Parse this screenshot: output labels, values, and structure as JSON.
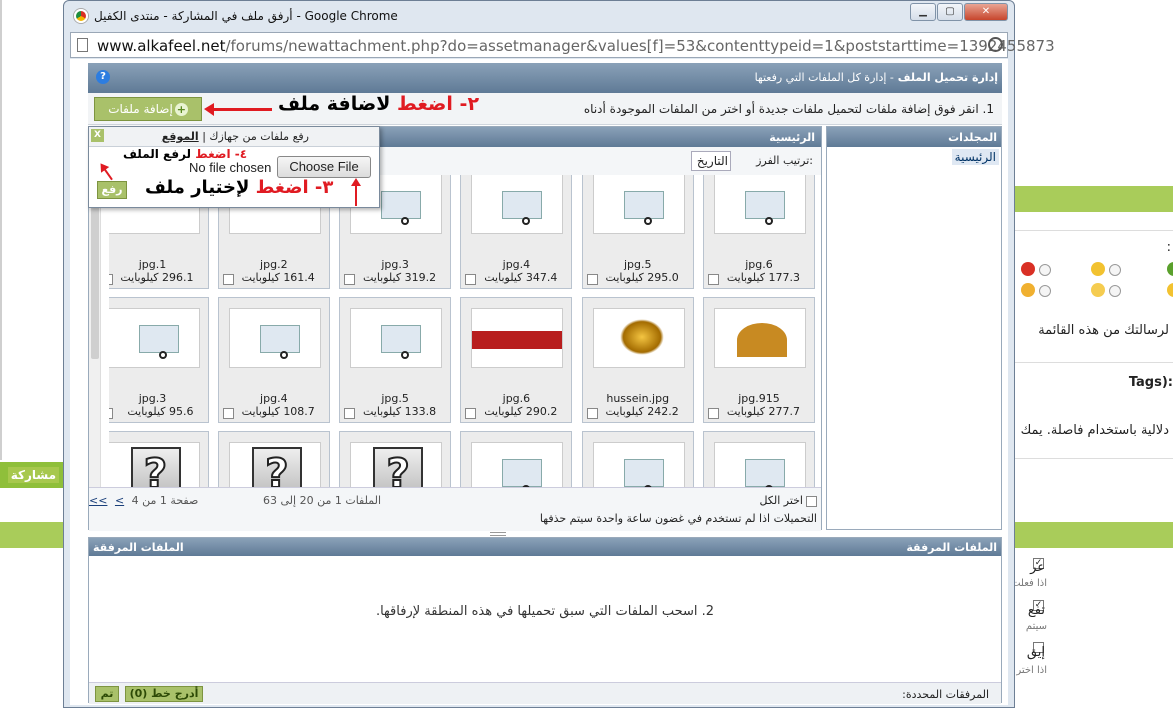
{
  "window": {
    "title": "أرفق ملف في المشاركة - منتدى الكفيل - Google Chrome",
    "url_host": "www.alkafeel.net",
    "url_path": "/forums/newattachment.php?do=assetmanager&values[f]=53&contenttypeid=1&poststarttime=1392455873"
  },
  "manager": {
    "title": "إدارة تحميل الملف",
    "subtitle": "- إدارة كل الملفات التي رفعتها",
    "instruction": "1. انقر فوق إضافة ملفات لتحميل ملفات جديدة أو اختر من الملفات الموجودة أدناه",
    "add_button": "إضافة ملفات"
  },
  "annotations": {
    "step2_num": "٢- ",
    "step2_red": "اضغط",
    "step2_black": " لاضافة ملف",
    "step3_num": "٣- ",
    "step3_red": "اضغط",
    "step3_black": " لإختيار ملف",
    "step4_num": "٤- ",
    "step4_red": "اضغط",
    "step4_black": " لرفع الملف"
  },
  "folders": {
    "title": "المجلدات",
    "item": "الرئيسية"
  },
  "files": {
    "title": "الرئيسية",
    "sort_label": "ترتيب الفرز:",
    "sort_value": "التاريخ",
    "tiles": [
      {
        "name": "jpg.6",
        "size": "177.3 كيلوبايت",
        "kind": "shot"
      },
      {
        "name": "jpg.5",
        "size": "295.0 كيلوبايت",
        "kind": "shot"
      },
      {
        "name": "jpg.4",
        "size": "347.4 كيلوبايت",
        "kind": "shot"
      },
      {
        "name": "jpg.3",
        "size": "319.2 كيلوبايت",
        "kind": "shot"
      },
      {
        "name": "jpg.2",
        "size": "161.4 كيلوبايت",
        "kind": "blank"
      },
      {
        "name": "jpg.1",
        "size": "296.1 كيلوبايت",
        "kind": "blank"
      },
      {
        "name": "jpg.915",
        "size": "277.7 كيلوبايت",
        "kind": "shrine"
      },
      {
        "name": "hussein.jpg",
        "size": "242.2 كيلوبايت",
        "kind": "black"
      },
      {
        "name": "jpg.6",
        "size": "290.2 كيلوبايت",
        "kind": "red"
      },
      {
        "name": "jpg.5",
        "size": "133.8 كيلوبايت",
        "kind": "shot"
      },
      {
        "name": "jpg.4",
        "size": "108.7 كيلوبايت",
        "kind": "shot"
      },
      {
        "name": "jpg.3",
        "size": "95.6 كيلوبايت",
        "kind": "shot"
      },
      {
        "name": "",
        "size": "",
        "kind": "shot"
      },
      {
        "name": "",
        "size": "",
        "kind": "shot"
      },
      {
        "name": "",
        "size": "",
        "kind": "shot"
      },
      {
        "name": "",
        "size": "",
        "kind": "q"
      },
      {
        "name": "",
        "size": "",
        "kind": "q"
      },
      {
        "name": "",
        "size": "",
        "kind": "q"
      }
    ],
    "select_all": "اختر الكل",
    "note": "التحميلات اذا لم تستخدم في غضون ساعة واحدة سيتم حذفها",
    "range": "الملفات 1 من 20 إلى 63",
    "page_info": "صفحة 1 من 4",
    "nav_prev": "<",
    "nav_first": "<<"
  },
  "upload": {
    "tab_from_computer": "رفع ملفات من جهازك",
    "separator": "|",
    "tab_site": "الموقع",
    "close": "X",
    "no_file": "No file chosen",
    "choose_button": "Choose File",
    "upload_button": "رفع"
  },
  "attached": {
    "title_right": "الملفات المرفقة",
    "title_left": "الملفات المرفقة",
    "drop_text": "2. اسحب الملفات التي سبق تحميلها في هذه المنطقة لإرفاقها.",
    "selected_label": "المرفقات المحددة:",
    "insert_button": "أدرج خط (0)",
    "done_button": "تم"
  },
  "background": {
    "left_button": "مشاركة",
    "line1": "لرسالتك من هذه القائمة",
    "tags": "Tags):",
    "line2": "دلالية باستخدام فاصلة. يمك",
    "colon": ":",
    "opt1": "عر",
    "opt1_small": "اذا فعلت",
    "opt2": "تفع",
    "opt2_small": "سيتم",
    "opt3": "إيق",
    "opt3_small": "اذا اختر"
  }
}
